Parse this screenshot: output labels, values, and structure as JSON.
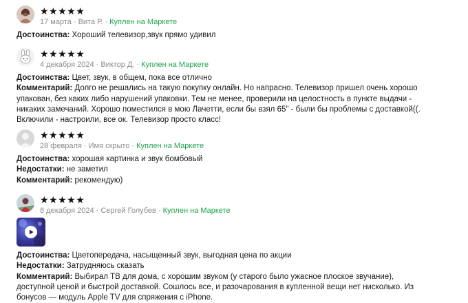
{
  "reviews": [
    {
      "rating": "★★★★★",
      "date": "17 марта",
      "author": "Вита Р.",
      "badge": "Куплен на Маркете",
      "avatar_icon": "user-photo-avatar",
      "lines": [
        {
          "label": "Достоинства:",
          "text": " Хороший телевизор,звук прямо удивил"
        }
      ]
    },
    {
      "rating": "★★★★★",
      "date": "4 декабря 2024",
      "author": "Виктор Д.",
      "badge": "Куплен на Маркете",
      "avatar_icon": "bunny-avatar",
      "lines": [
        {
          "label": "Достоинства:",
          "text": " Цвет, звук, в общем, пока все отлично"
        },
        {
          "label": "Комментарий:",
          "text": " Долго не решались на такую покупку онлайн. Но напрасно. Телевизор пришел очень хорошо"
        },
        {
          "label": "",
          "text": "упакован, без каких либо нарушений упаковки. Тем не менее, проверили на целостность в пункте выдачи -"
        },
        {
          "label": "",
          "text": "никаких замечаний. Хорошо поместился в мою Лачетти, если бы взял 65\" - были бы проблемы с доставкой((."
        },
        {
          "label": "",
          "text": "Включили - настроили, все ок. Телевизор просто класс!"
        }
      ]
    },
    {
      "rating": "★★★★★",
      "date": "28 февраля",
      "author": "Имя скрыто",
      "badge": "Куплен на Маркете",
      "avatar_icon": "default-avatar",
      "lines": [
        {
          "label": "Достоинства:",
          "text": " хорошая картинка и звук бомбовый"
        },
        {
          "label": "Недостатки:",
          "text": " не заметил"
        },
        {
          "label": "Комментарий:",
          "text": " рекомендую)"
        }
      ]
    },
    {
      "rating": "★★★★★",
      "date": "8 декабря 2024",
      "author": "Сергей Голубев",
      "badge": "Куплен на Маркете",
      "avatar_icon": "user-photo-avatar",
      "media": "video-thumbnail",
      "lines": [
        {
          "label": "Достоинства:",
          "text": " Цветопередача, насыщенный звук, выгодная цена по акции"
        },
        {
          "label": "Недостатки:",
          "text": " Затрудняюсь сказать"
        },
        {
          "label": "Комментарий:",
          "text": " Выбирал ТВ для дома, с хорошим звуком (у старого было ужасное плоское звучание),"
        },
        {
          "label": "",
          "text": "доступной ценой и быстрой доставкой. Сошлось все, и разочарования в купленной вещи нет нисколько. Из"
        },
        {
          "label": "",
          "text": "бонусов — модуль Apple TV для спряжения с iPhone."
        }
      ]
    }
  ],
  "colors": {
    "badge_green": "#1fa34a",
    "meta_gray": "#8a8a8a",
    "star": "#111111"
  }
}
